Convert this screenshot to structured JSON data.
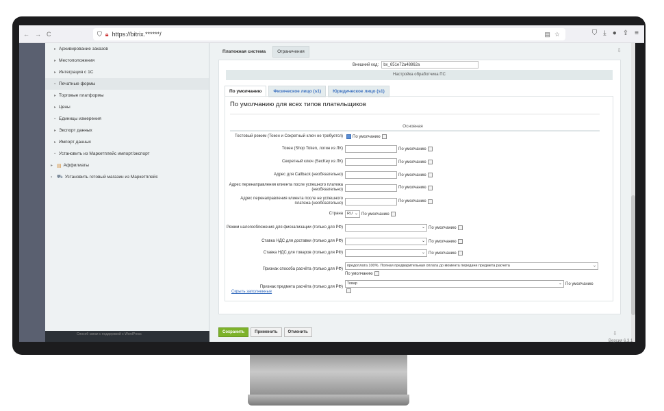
{
  "browser": {
    "url": "https://bitrix.******/",
    "nav": [
      "←",
      "→",
      "C"
    ]
  },
  "sidebar": {
    "items": [
      {
        "label": "Архивирование заказов",
        "level": 2
      },
      {
        "label": "Местоположения",
        "level": 2
      },
      {
        "label": "Интеграция с 1С",
        "level": 2
      },
      {
        "label": "Печатные формы",
        "level": 2,
        "active": true
      },
      {
        "label": "Торговые платформы",
        "level": 2
      },
      {
        "label": "Цены",
        "level": 2
      },
      {
        "label": "Единицы измерения",
        "level": 2
      },
      {
        "label": "Экспорт данных",
        "level": 2
      },
      {
        "label": "Импорт данных",
        "level": 2
      },
      {
        "label": "Установить из Маркетплейс импорт/экспорт",
        "level": 2
      },
      {
        "label": "Аффилиаты",
        "level": 1,
        "icon": "folder-icon"
      },
      {
        "label": "Установить готовый магазин из Маркетплейс",
        "level": 1,
        "icon": "cart-icon"
      }
    ],
    "footer": "Способ связи с поддержкой с WordPress"
  },
  "main": {
    "tabs": [
      {
        "label": "Платежная система",
        "active": true
      },
      {
        "label": "Ограничения",
        "active": false
      }
    ],
    "ext_code_label": "Внешний код:",
    "ext_code_value": "bx_651e72a48862a",
    "handler_bar": "Настройка обработчика ПС",
    "sub_tabs": [
      {
        "label": "По умолчанию",
        "active": true
      },
      {
        "label": "Физическое лицо (s1)",
        "active": false
      },
      {
        "label": "Юридическое лицо (s1)",
        "active": false
      }
    ],
    "panel_title": "По умолчанию для всех типов плательщиков",
    "section_title": "Основная",
    "default_label": "По умолчанию",
    "fields": {
      "test_mode": "Тестовый режим (Токен и Секретный ключ не требуется)",
      "token": "Токен (Shop Token, логин из ЛК)",
      "secret": "Секретный ключ (SecKey из ЛК)",
      "callback": "Адрес для Callback (необязательно)",
      "redirect_ok": "Адрес перенаправления клиента после успешного платежа (необязательно)",
      "redirect_fail": "Адрес перенаправления клиента после не успешного платежа (необязательно)",
      "country": "Страна",
      "country_value": "RU",
      "tax_mode": "Режим налогообложения для фискализации (только для РФ)",
      "vat_delivery": "Ставка НДС для доставки (только для РФ)",
      "vat_goods": "Ставка НДС для товаров (только для РФ)",
      "pay_method": "Признак способа расчёта (только для РФ)",
      "pay_method_value": "предоплата 100%. Полная предварительная оплата до момента передачи предмета расчета",
      "pay_subject": "Признак предмета расчёта (только для РФ)",
      "pay_subject_value": "Товар"
    },
    "hide_link": "Скрыть заполненные"
  },
  "buttons": {
    "save": "Сохранить",
    "apply": "Применить",
    "cancel": "Отменить"
  },
  "version": "Версия 6.3.1"
}
